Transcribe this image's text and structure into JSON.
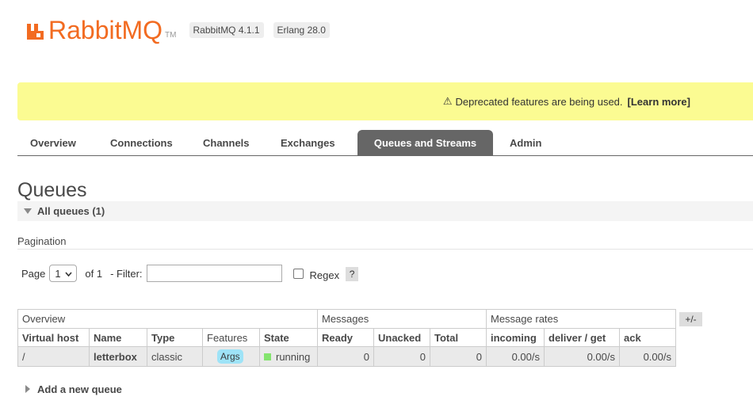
{
  "header": {
    "logo_rabbit": "Rabbit",
    "logo_mq": "MQ",
    "logo_tm": "TM",
    "rabbitmq_version": "RabbitMQ 4.1.1",
    "erlang_version": "Erlang 28.0"
  },
  "warning": {
    "icon": "⚠",
    "text": "Deprecated features are being used.",
    "link": "[Learn more]"
  },
  "tabs": {
    "overview": "Overview",
    "connections": "Connections",
    "channels": "Channels",
    "exchanges": "Exchanges",
    "queues": "Queues and Streams",
    "admin": "Admin"
  },
  "page": {
    "title": "Queues",
    "section": "All queues (1)",
    "pagination_label": "Pagination",
    "page_label": "Page",
    "page_value": "1",
    "of_label": "of 1",
    "filter_label": "- Filter:",
    "filter_value": "",
    "regex_label": "Regex",
    "help": "?"
  },
  "table": {
    "groups": {
      "overview": "Overview",
      "messages": "Messages",
      "rates": "Message rates"
    },
    "columns": {
      "vhost": "Virtual host",
      "name": "Name",
      "type": "Type",
      "features": "Features",
      "state": "State",
      "ready": "Ready",
      "unacked": "Unacked",
      "total": "Total",
      "incoming": "incoming",
      "deliver": "deliver / get",
      "ack": "ack"
    },
    "row": {
      "vhost": "/",
      "name": "letterbox",
      "type": "classic",
      "features": "Args",
      "state": "running",
      "ready": "0",
      "unacked": "0",
      "total": "0",
      "incoming": "0.00/s",
      "deliver": "0.00/s",
      "ack": "0.00/s"
    },
    "plusminus": "+/-"
  },
  "add_queue": "Add a new queue",
  "colors": {
    "brand_orange": "#f26b21",
    "warning_bg": "#fbfb92",
    "active_tab_bg": "#666666",
    "args_badge": "#9ee3f7",
    "running_green": "#84e46e"
  }
}
